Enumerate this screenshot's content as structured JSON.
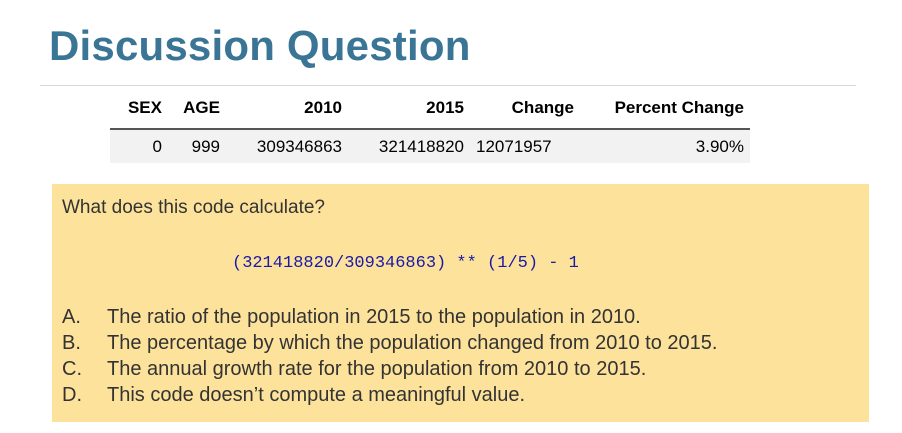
{
  "title": "Discussion Question",
  "table": {
    "headers": [
      "SEX",
      "AGE",
      "2010",
      "2015",
      "Change",
      "Percent Change"
    ],
    "row": [
      "0",
      "999",
      "309346863",
      "321418820",
      "12071957",
      "3.90%"
    ]
  },
  "question": {
    "prompt": "What does this code calculate?",
    "code": "(321418820/309346863) ** (1/5) - 1",
    "choices": [
      {
        "letter": "A.",
        "text": "The ratio of the population in 2015 to the population in 2010."
      },
      {
        "letter": "B.",
        "text": "The percentage by which the population changed from 2010 to 2015."
      },
      {
        "letter": "C.",
        "text": "The annual growth rate for the population from 2010 to 2015."
      },
      {
        "letter": "D.",
        "text": "This code doesn’t compute a meaningful value."
      }
    ]
  },
  "colors": {
    "title": "#3a7596",
    "question_box": "#fce29b",
    "code": "#1a1aa8"
  }
}
